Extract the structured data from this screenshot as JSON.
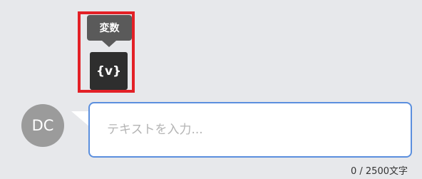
{
  "variable_tool": {
    "tooltip_label": "変数",
    "button_label": "{v}"
  },
  "avatar": {
    "initials": "DC"
  },
  "message_input": {
    "placeholder": "テキストを入力..."
  },
  "char_counter": {
    "text": "0 / 2500文字"
  },
  "colors": {
    "highlight": "#e32026",
    "input_border": "#5b8fde",
    "tooltip_bg": "#5a5a5a",
    "button_bg": "#2e2e2e",
    "avatar_bg": "#9b9b9b",
    "background": "#e7e8eb"
  }
}
